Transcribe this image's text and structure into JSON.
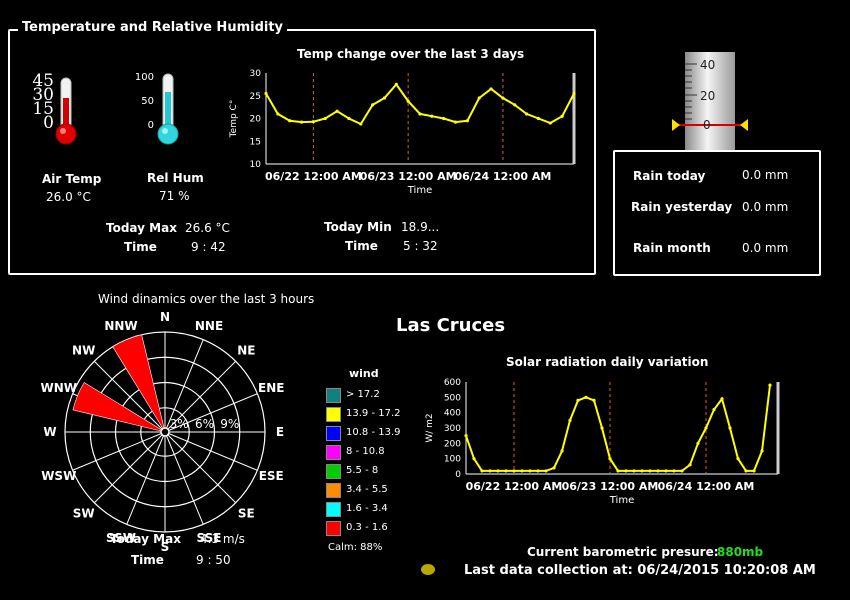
{
  "temp_panel": {
    "title": "Temperature and  Relative Humidity",
    "air_temp_label": "Air Temp",
    "air_temp_value": "26.0 °C",
    "rel_hum_label": "Rel Hum",
    "rel_hum_value": "71 %",
    "temp_scale": [
      "45",
      "30",
      "15",
      "0"
    ],
    "hum_scale": [
      "100",
      "50",
      "0"
    ],
    "today_max_label": "Today Max",
    "today_max_value": "26.6 °C",
    "max_time_label": "Time",
    "max_time_value": "9 : 42",
    "today_min_label": "Today Min",
    "today_min_value": "18.9...",
    "min_time_label": "Time",
    "min_time_value": "5 : 32"
  },
  "temp_chart": {
    "title": "Temp change over the last 3 days",
    "ylabel": "Temp C°",
    "xlabel": "Time",
    "yticks": [
      "30",
      "25",
      "20",
      "15",
      "10"
    ],
    "xticks": [
      "06/22 12:00 AM",
      "06/23 12:00 AM",
      "06/24 12:00 AM"
    ]
  },
  "rain_panel": {
    "gauge_ticks": [
      "40",
      "20",
      "0"
    ],
    "today_label": "Rain today",
    "today_value": "0.0 mm",
    "yesterday_label": "Rain yesterday",
    "yesterday_value": "0.0 mm",
    "month_label": "Rain month",
    "month_value": "0.0 mm"
  },
  "wind": {
    "title": "Wind dinamics over the last 3 hours",
    "directions": [
      "N",
      "NNE",
      "NE",
      "ENE",
      "E",
      "ESE",
      "SE",
      "SSE",
      "S",
      "SSW",
      "SW",
      "WSW",
      "W",
      "WNW",
      "NW",
      "NNW"
    ],
    "ring_labels": [
      "3%",
      "6%",
      "9%"
    ],
    "today_max_label": "Today Max",
    "today_max_value": "4.3 m/s",
    "time_label": "Time",
    "time_value": "9 : 50",
    "legend_title": "wind",
    "legend": [
      {
        "label": "> 17.2",
        "color": "#138080"
      },
      {
        "label": "13.9 - 17.2",
        "color": "#ffff00"
      },
      {
        "label": "10.8 - 13.9",
        "color": "#0000ff"
      },
      {
        "label": "8 - 10.8",
        "color": "#ff00ff"
      },
      {
        "label": "5.5 - 8",
        "color": "#00cc00"
      },
      {
        "label": "3.4 - 5.5",
        "color": "#ff8c00"
      },
      {
        "label": "1.6 - 3.4",
        "color": "#00ffff"
      },
      {
        "label": "0.3 - 1.6",
        "color": "#ff0000"
      }
    ],
    "calm": "Calm: 88%"
  },
  "station": {
    "name": "Las Cruces",
    "baro_label": "Current barometric presure:",
    "baro_value": "880mb",
    "last_collection": "Last data collection at: 06/24/2015 10:20:08 AM"
  },
  "solar_chart": {
    "title": "Solar radiation daily variation",
    "ylabel": "W/ m2",
    "xlabel": "Time",
    "yticks": [
      "600",
      "500",
      "400",
      "300",
      "200",
      "100",
      "0"
    ],
    "xticks": [
      "06/22 12:00 AM",
      "06/23 12:00 AM",
      "06/24 12:00 AM"
    ]
  },
  "chart_data": [
    {
      "type": "line",
      "title": "Temp change over the last 3 days",
      "xlabel": "Time",
      "ylabel": "Temp C°",
      "ylim": [
        10,
        30
      ],
      "x_hours": [
        0,
        3,
        6,
        9,
        12,
        15,
        18,
        21,
        24,
        27,
        30,
        33,
        36,
        39,
        42,
        45,
        48,
        51,
        54,
        57,
        60,
        63,
        66,
        69,
        72,
        75,
        78
      ],
      "series": [
        {
          "values": [
            25.5,
            21,
            19.5,
            19.2,
            19.3,
            20,
            21.6,
            20,
            18.8,
            23,
            24.5,
            27.5,
            23.8,
            21,
            20.5,
            20,
            19.2,
            19.5,
            24.5,
            26.5,
            24.5,
            23,
            21,
            20,
            19,
            20.5,
            25.5
          ]
        }
      ],
      "xticks": [
        "06/22 12:00 AM",
        "06/23 12:00 AM",
        "06/24 12:00 AM"
      ]
    },
    {
      "type": "line",
      "title": "Solar radiation daily variation",
      "xlabel": "Time",
      "ylabel": "W/ m2",
      "ylim": [
        0,
        600
      ],
      "x_hours": [
        0,
        2,
        4,
        6,
        8,
        10,
        12,
        14,
        16,
        18,
        20,
        22,
        24,
        26,
        28,
        30,
        32,
        34,
        36,
        38,
        40,
        42,
        44,
        46,
        48,
        50,
        52,
        54,
        56,
        58,
        60,
        62,
        64,
        66,
        68,
        70,
        72,
        74,
        76
      ],
      "series": [
        {
          "values": [
            250,
            100,
            20,
            20,
            20,
            20,
            20,
            20,
            20,
            20,
            20,
            40,
            150,
            350,
            480,
            500,
            480,
            300,
            100,
            20,
            20,
            20,
            20,
            20,
            20,
            20,
            20,
            20,
            60,
            200,
            300,
            420,
            490,
            300,
            100,
            20,
            20,
            150,
            580
          ]
        }
      ],
      "xticks": [
        "06/22 12:00 AM",
        "06/23 12:00 AM",
        "06/24 12:00 AM"
      ]
    },
    {
      "type": "wind-rose",
      "title": "Wind dinamics over the last 3 hours",
      "ring_percent": [
        3,
        6,
        9
      ],
      "petals": [
        {
          "direction": "NNW",
          "speed_class": "0.3 - 1.6",
          "percent": 9.5
        },
        {
          "direction": "WNW",
          "speed_class": "0.3 - 1.6",
          "percent": 9.0
        }
      ],
      "calm_percent": 88
    }
  ]
}
